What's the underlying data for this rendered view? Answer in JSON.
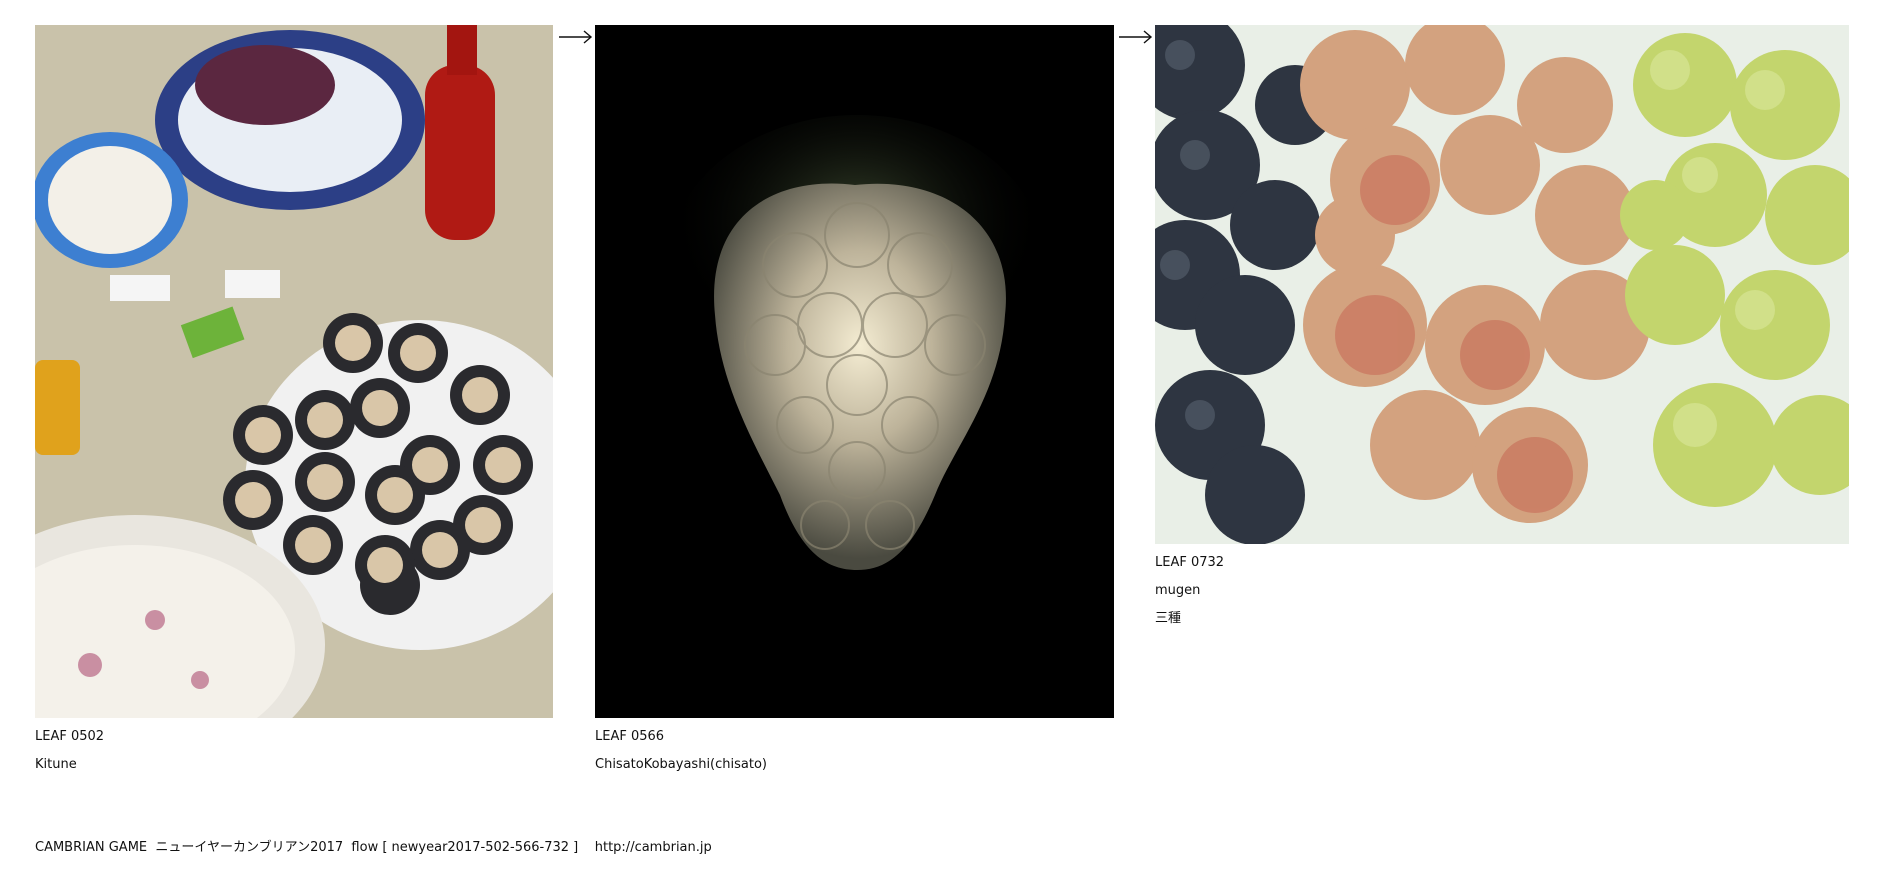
{
  "panels": [
    {
      "leaf": "LEAF 0502",
      "author": "Kitune",
      "note": "",
      "image": "sushi-rolls-table-photo"
    },
    {
      "leaf": "LEAF 0566",
      "author": "ChisatoKobayashi(chisato)",
      "note": "",
      "image": "glowing-grape-lamp-photo"
    },
    {
      "leaf": "LEAF 0732",
      "author": "mugen",
      "note": "三種",
      "image": "three-grape-varieties-photo"
    }
  ],
  "arrows": [
    "arrow-icon",
    "arrow-icon"
  ],
  "footer": {
    "text": "CAMBRIAN GAME  ニューイヤーカンブリアン2017  flow [ newyear2017-502-566-732 ]    http://cambrian.jp"
  }
}
